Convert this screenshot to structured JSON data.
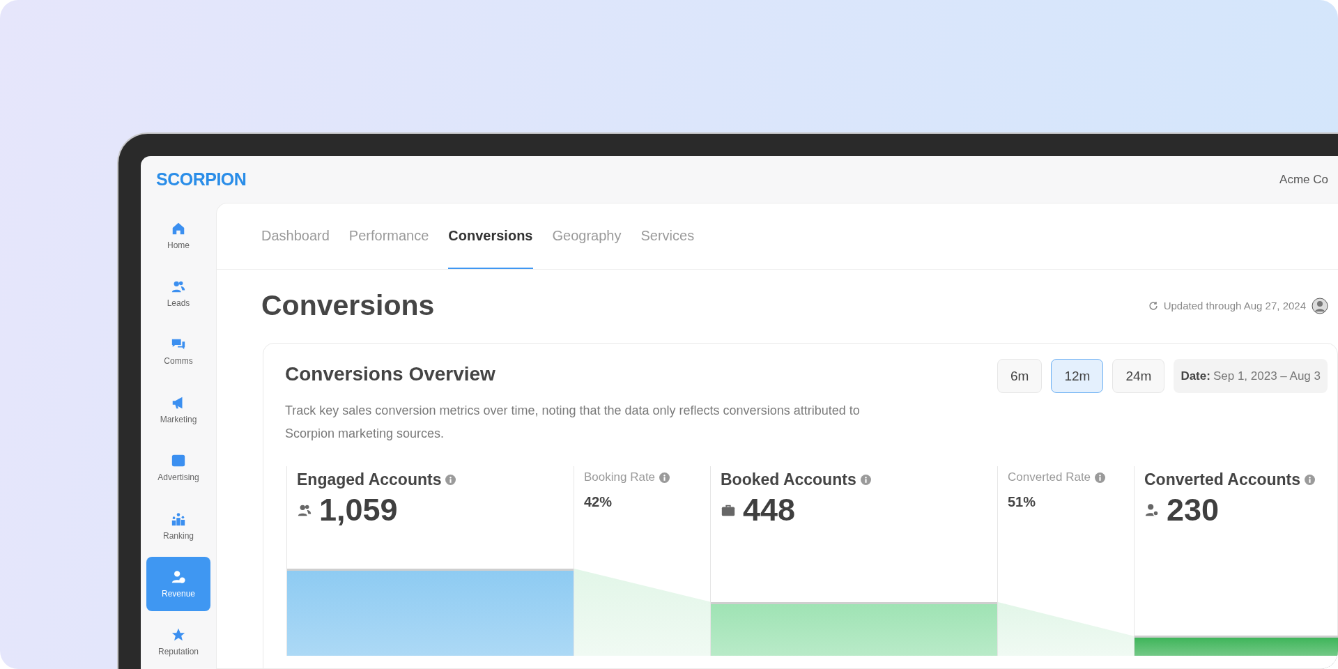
{
  "header": {
    "logo": "SCORPION",
    "account": "Acme Co"
  },
  "sidebar": [
    {
      "label": "Home",
      "selected": false
    },
    {
      "label": "Leads",
      "selected": false
    },
    {
      "label": "Comms",
      "selected": false
    },
    {
      "label": "Marketing",
      "selected": false
    },
    {
      "label": "Advertising",
      "selected": false
    },
    {
      "label": "Ranking",
      "selected": false
    },
    {
      "label": "Revenue",
      "selected": true
    },
    {
      "label": "Reputation",
      "selected": false
    }
  ],
  "tabs": [
    {
      "label": "Dashboard",
      "selected": false
    },
    {
      "label": "Performance",
      "selected": false
    },
    {
      "label": "Conversions",
      "selected": true
    },
    {
      "label": "Geography",
      "selected": false
    },
    {
      "label": "Services",
      "selected": false
    }
  ],
  "page": {
    "title": "Conversions",
    "updated": "Updated through Aug 27, 2024"
  },
  "overview": {
    "title": "Conversions Overview",
    "description": "Track key sales conversion metrics over time, noting that the data only reflects conversions attributed to Scorpion marketing sources.",
    "ranges": [
      {
        "label": "6m",
        "selected": false
      },
      {
        "label": "12m",
        "selected": true
      },
      {
        "label": "24m",
        "selected": false
      }
    ],
    "date_label": "Date:",
    "date_value": "Sep 1, 2023 – Aug 3"
  },
  "funnel": [
    {
      "kind": "stage",
      "label": "Engaged Accounts",
      "value": "1,059",
      "color": "#8ecbf2"
    },
    {
      "kind": "rate",
      "label": "Booking Rate",
      "value": "42%"
    },
    {
      "kind": "stage",
      "label": "Booked Accounts",
      "value": "448",
      "color": "#9fe3b4"
    },
    {
      "kind": "rate",
      "label": "Converted Rate",
      "value": "51%"
    },
    {
      "kind": "stage",
      "label": "Converted Accounts",
      "value": "230",
      "color": "#3fb55a"
    }
  ]
}
